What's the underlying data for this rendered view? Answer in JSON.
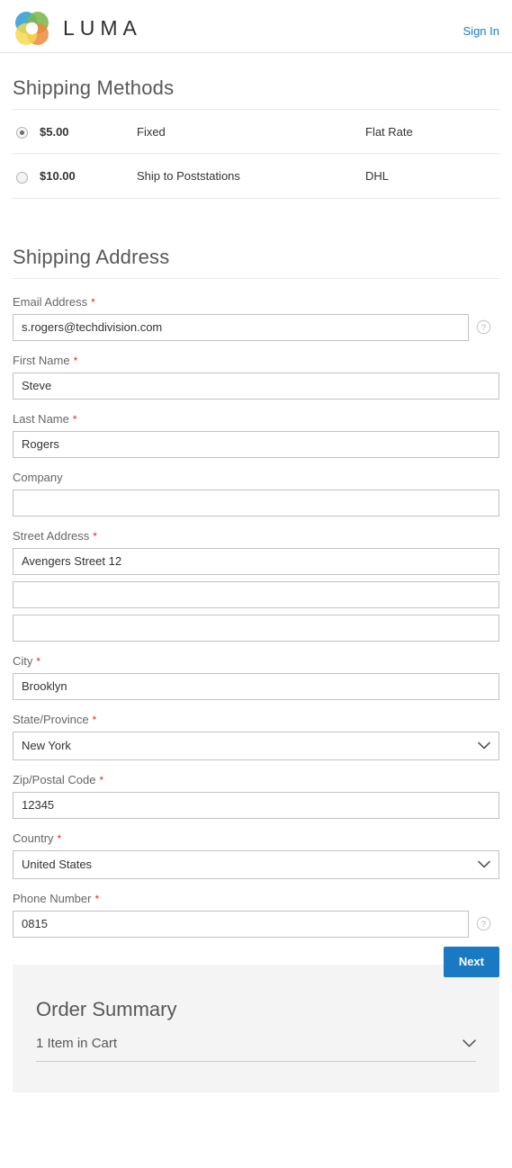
{
  "header": {
    "brand_name": "LUMA",
    "logo_icon": "luma-flower-logo",
    "sign_in_label": "Sign In",
    "link_color": "#1979c3"
  },
  "shipping_methods": {
    "title": "Shipping Methods",
    "rows": [
      {
        "selected": true,
        "price": "$5.00",
        "method": "Fixed",
        "carrier": "Flat Rate"
      },
      {
        "selected": false,
        "price": "$10.00",
        "method": "Ship to Poststations",
        "carrier": "DHL"
      }
    ]
  },
  "shipping_address": {
    "title": "Shipping Address",
    "required_marker": "*",
    "fields": {
      "email": {
        "label": "Email Address",
        "value": "s.rogers@techdivision.com",
        "placeholder": "",
        "required": true,
        "help_icon": "question-circle-icon"
      },
      "first_name": {
        "label": "First Name",
        "value": "Steve",
        "placeholder": "",
        "required": true
      },
      "last_name": {
        "label": "Last Name",
        "value": "Rogers",
        "placeholder": "",
        "required": true
      },
      "company": {
        "label": "Company",
        "value": "",
        "placeholder": "",
        "required": false
      },
      "street": {
        "label": "Street Address",
        "required": true,
        "line1": "Avengers Street 12",
        "line2": "",
        "line3": ""
      },
      "city": {
        "label": "City",
        "value": "Brooklyn",
        "placeholder": "",
        "required": true
      },
      "state": {
        "label": "State/Province",
        "value": "New York",
        "required": true,
        "chevron_icon": "chevron-down-icon"
      },
      "zip": {
        "label": "Zip/Postal Code",
        "value": "12345",
        "placeholder": "",
        "required": true
      },
      "country": {
        "label": "Country",
        "value": "United States",
        "required": true,
        "chevron_icon": "chevron-down-icon"
      },
      "phone": {
        "label": "Phone Number",
        "value": "0815",
        "placeholder": "",
        "required": true,
        "help_icon": "question-circle-icon"
      }
    }
  },
  "order_summary": {
    "title": "Order Summary",
    "cart_label": "1 Item in Cart",
    "cart_chevron_icon": "chevron-down-icon",
    "next_label": "Next",
    "next_color": "#1979c3",
    "background": "#f4f4f4"
  }
}
